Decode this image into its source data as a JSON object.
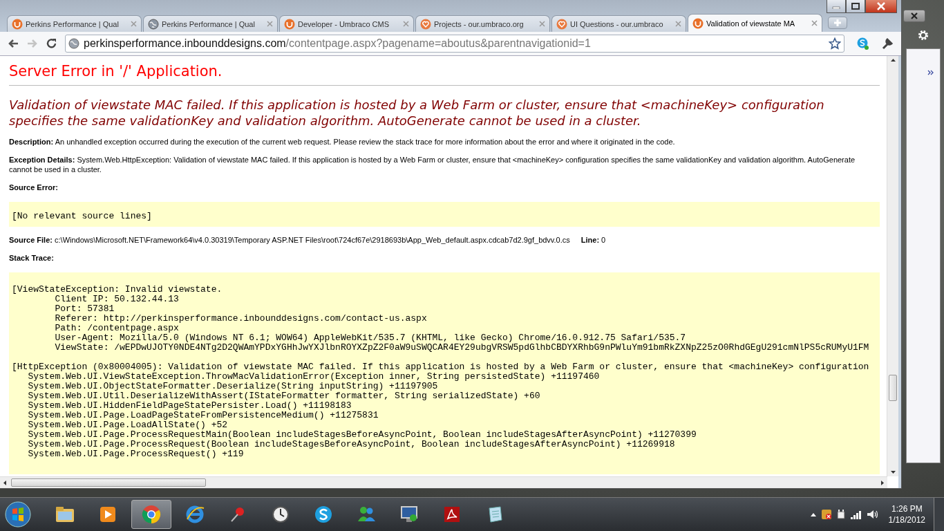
{
  "tabs": [
    {
      "title": "Perkins Performance | Qual",
      "kind": "umbraco",
      "selected": false
    },
    {
      "title": "Perkins Performance | Qual",
      "kind": "globe",
      "selected": false
    },
    {
      "title": "Developer - Umbraco CMS",
      "kind": "umbraco",
      "selected": false
    },
    {
      "title": "Projects - our.umbraco.org",
      "kind": "heart",
      "selected": false
    },
    {
      "title": "UI Questions - our.umbraco",
      "kind": "heart",
      "selected": false
    },
    {
      "title": "Validation of viewstate MA",
      "kind": "umbraco",
      "selected": true
    }
  ],
  "address_bar": {
    "host": "perkinsperformance.inbounddesigns.com",
    "path": "/contentpage.aspx?pagename=aboutus&parentnavigationid=1"
  },
  "page": {
    "title": "Server Error in '/' Application.",
    "message": "Validation of viewstate MAC failed. If this application is hosted by a Web Farm or cluster, ensure that <machineKey> configuration specifies the same validationKey and validation algorithm. AutoGenerate cannot be used in a cluster.",
    "sections": [
      "**Description:** An unhandled exception occurred during the execution of the current web request. Please review the stack trace for more information about the error and where it originated in the code.",
      "**Exception Details:** System.Web.HttpException: Validation of viewstate MAC failed. If this application is hosted by a Web Farm or cluster, ensure that <machineKey> configuration specifies the same validationKey and validation algorithm. AutoGenerate cannot be used in a cluster."
    ],
    "source_error": {
      "label": "Source Error:",
      "code": "[No relevant source lines]"
    },
    "source_file": "**Source File:** c:\\Windows\\Microsoft.NET\\Framework64\\v4.0.30319\\Temporary ASP.NET Files\\root\\724cf67e\\2918693b\\App_Web_default.aspx.cdcab7d2.9gf_bdvv.0.cs",
    "line": "**Line:** 0",
    "stack_trace": {
      "label": "Stack Trace:",
      "blocks": [
        "[ViewStateException: Invalid viewstate.\n\tClient IP: 50.132.44.13\n\tPort: 57381\n\tReferer: http://perkinsperformance.inbounddesigns.com/contact-us.aspx\n\tPath: /contentpage.aspx\n\tUser-Agent: Mozilla/5.0 (Windows NT 6.1; WOW64) AppleWebKit/535.7 (KHTML, like Gecko) Chrome/16.0.912.75 Safari/535.7\n\tViewState: /wEPDwUJOTY0NDE4NTg2D2QWAmYPDxYGHhJwYXJlbnROYXZpZ2F0aW9uSWQCAR4EY29ubgVRSW5pdGlhbCBDYXRhbG9nPWluYm91bmRkZXNpZ25zO0RhdGEgU291cmNlPS5cRUMyU1FM",
        "[HttpException (0x80004005): Validation of viewstate MAC failed. If this application is hosted by a Web Farm or cluster, ensure that <machineKey> configuration\n   System.Web.UI.ViewStateException.ThrowMacValidationError(Exception inner, String persistedState) +11197460\n   System.Web.UI.ObjectStateFormatter.Deserialize(String inputString) +11197905\n   System.Web.UI.Util.DeserializeWithAssert(IStateFormatter formatter, String serializedState) +60\n   System.Web.UI.HiddenFieldPageStatePersister.Load() +11198183\n   System.Web.UI.Page.LoadPageStateFromPersistenceMedium() +11275831\n   System.Web.UI.Page.LoadAllState() +52\n   System.Web.UI.Page.ProcessRequestMain(Boolean includeStagesBeforeAsyncPoint, Boolean includeStagesAfterAsyncPoint) +11270399\n   System.Web.UI.Page.ProcessRequest(Boolean includeStagesBeforeAsyncPoint, Boolean includeStagesAfterAsyncPoint) +11269918\n   System.Web.UI.Page.ProcessRequest() +119"
      ]
    }
  },
  "clock": {
    "time": "1:26 PM",
    "date": "1/18/2012"
  }
}
